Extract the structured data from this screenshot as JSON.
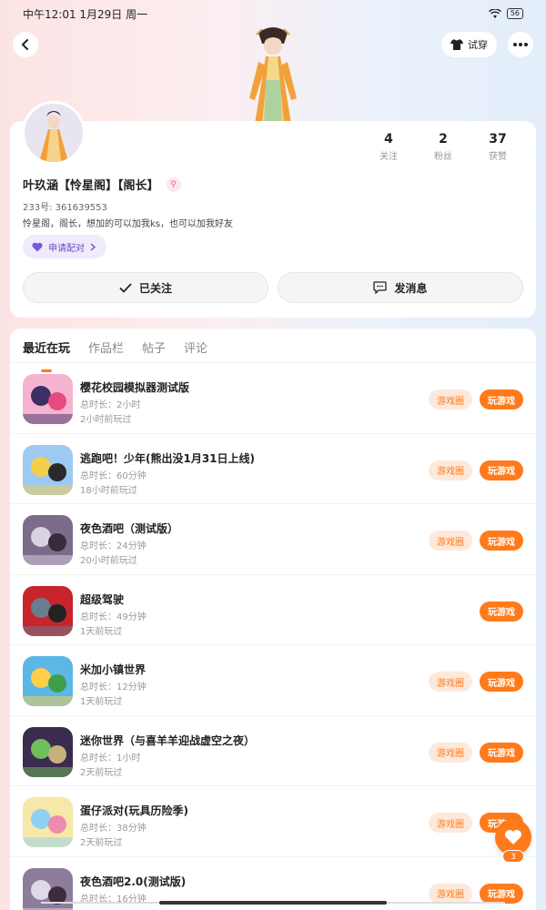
{
  "status_bar": {
    "time": "中午12:01 1月29日 周一",
    "battery": "56"
  },
  "nav": {
    "tryon_label": "试穿"
  },
  "profile": {
    "stats": [
      {
        "num": "4",
        "label": "关注"
      },
      {
        "num": "2",
        "label": "粉丝"
      },
      {
        "num": "37",
        "label": "获赞"
      }
    ],
    "name": "叶玖涵【怜星阁】【阁长】",
    "uid": "233号: 361639553",
    "bio": "怜星阁，阁长，想加的可以加我ks，也可以加我好友",
    "pair_label": "申请配对",
    "follow_label": "已关注",
    "message_label": "发消息"
  },
  "tabs": [
    "最近在玩",
    "作品栏",
    "帖子",
    "评论"
  ],
  "games": [
    {
      "name": "樱花校园模拟器测试版",
      "duration": "总时长：2小时",
      "last": "2小时前玩过",
      "has_circle": true
    },
    {
      "name": "逃跑吧！少年(熊出没1月31日上线)",
      "duration": "总时长：60分钟",
      "last": "18小时前玩过",
      "has_circle": true
    },
    {
      "name": "夜色酒吧（测试版）",
      "duration": "总时长：24分钟",
      "last": "20小时前玩过",
      "has_circle": true
    },
    {
      "name": "超级驾驶",
      "duration": "总时长：49分钟",
      "last": "1天前玩过",
      "has_circle": false
    },
    {
      "name": "米加小镇世界",
      "duration": "总时长：12分钟",
      "last": "1天前玩过",
      "has_circle": true
    },
    {
      "name": "迷你世界（与喜羊羊迎战虚空之夜）",
      "duration": "总时长：1小时",
      "last": "2天前玩过",
      "has_circle": true
    },
    {
      "name": "蛋仔派对(玩具历险季)",
      "duration": "总时长：38分钟",
      "last": "2天前玩过",
      "has_circle": true
    },
    {
      "name": "夜色酒吧2.0(测试版)",
      "duration": "总时长：16分钟",
      "last": "",
      "has_circle": true
    }
  ],
  "buttons": {
    "circle_label": "游戏圈",
    "play_label": "玩游戏"
  },
  "fab_count": "3",
  "colors": {
    "accent": "#ff7a1a",
    "pair_bg": "#efeafc",
    "pair_text": "#6b4bc8"
  }
}
